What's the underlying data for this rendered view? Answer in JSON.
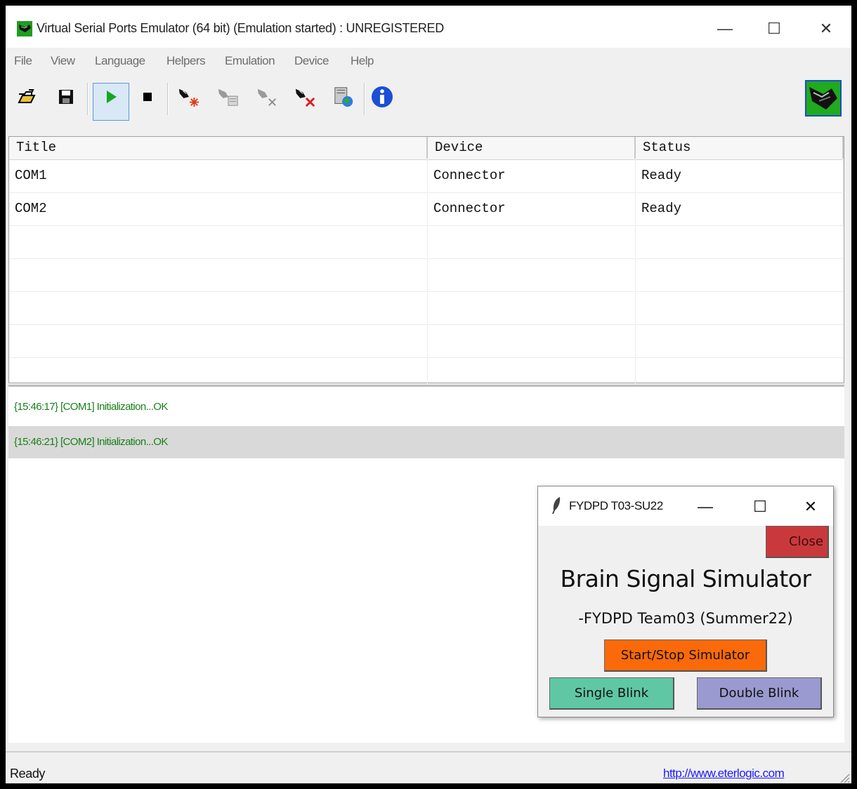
{
  "window": {
    "title": "Virtual Serial Ports Emulator (64 bit) (Emulation started) : UNREGISTERED",
    "minimize": "—",
    "maximize": "☐",
    "close": "✕"
  },
  "menu": [
    "File",
    "View",
    "Language",
    "Helpers",
    "Emulation",
    "Device",
    "Help"
  ],
  "toolbar": {
    "icons": [
      "open-folder-icon",
      "save-disk-icon",
      "start-emulation-icon",
      "stop-emulation-icon",
      "create-device-icon",
      "edit-device-icon",
      "disconnect-device-icon",
      "delete-device-icon",
      "device-network-icon",
      "info-icon"
    ]
  },
  "table": {
    "columns": [
      "Title",
      "Device",
      "Status"
    ],
    "rows": [
      [
        "COM1",
        "Connector",
        "Ready"
      ],
      [
        "COM2",
        "Connector",
        "Ready"
      ]
    ]
  },
  "log": [
    "{15:46:17} [COM1] Initialization...OK",
    "{15:46:21} [COM2] Initialization...OK"
  ],
  "statusbar": {
    "text": "Ready",
    "link": "http://www.eterlogic.com"
  },
  "dialog": {
    "title": "FYDPD T03-SU22",
    "minimize": "—",
    "maximize": "☐",
    "close_x": "✕",
    "close_button": "Close",
    "heading": "Brain Signal Simulator",
    "subheading": "-FYDPD Team03 (Summer22)",
    "start_stop": "Start/Stop Simulator",
    "single_blink": "Single Blink",
    "double_blink": "Double Blink"
  },
  "colors": {
    "log_text": "#1a7f1a",
    "close_button": "#c9393b",
    "start_button": "#fa6a0a",
    "single_button": "#5fc7a4",
    "double_button": "#9b9ad0"
  }
}
